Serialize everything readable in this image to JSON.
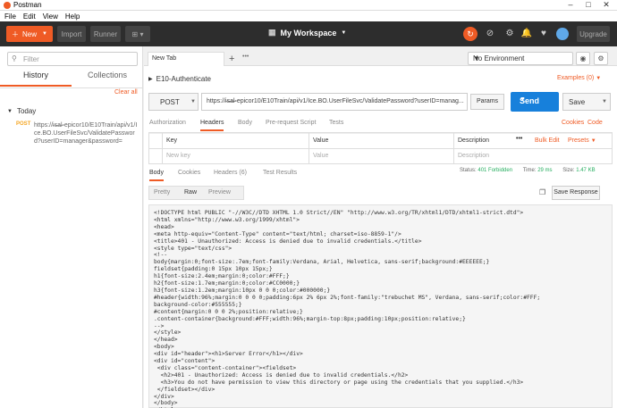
{
  "titlebar": {
    "title": "Postman",
    "min": "–",
    "max": "□",
    "close": "✕"
  },
  "menu": [
    "File",
    "Edit",
    "View",
    "Help"
  ],
  "toolbar": {
    "new_label": "New",
    "import_label": "Import",
    "runner_label": "Runner",
    "workspace": "My Workspace",
    "upgrade_label": "Upgrade"
  },
  "sidebar": {
    "filter_placeholder": "Filter",
    "tabs": [
      "History",
      "Collections"
    ],
    "clear_all": "Clear all",
    "group": "Today",
    "item": {
      "method": "POST",
      "url": "https://i̶s̶a̶l̶-epicor10/E10Train/api/v1/Ice.BO.UserFileSvc/ValidatePassword?userID=manager&password="
    }
  },
  "tabbar": {
    "tab_label": "New Tab",
    "new_tab": "+"
  },
  "environment": {
    "selected": "No Environment"
  },
  "request": {
    "name": "E10-Authenticate",
    "examples": "Examples (0)",
    "method": "POST",
    "url": "https://i̶s̶a̶l̶-epicor10/E10Train/api/v1/Ice.BO.UserFileSvc/ValidatePassword?userID=manag...",
    "params_label": "Params",
    "send_label": "Send",
    "save_label": "Save"
  },
  "subtabs": [
    "Authorization",
    "Headers",
    "Body",
    "Pre-request Script",
    "Tests"
  ],
  "links": {
    "cookies": "Cookies",
    "code": "Code"
  },
  "headers_table": {
    "col_key": "Key",
    "col_value": "Value",
    "col_description": "Description",
    "bulk_edit": "Bulk Edit",
    "presets": "Presets",
    "new_key": "New key",
    "new_value": "Value",
    "new_desc": "Description"
  },
  "response_tabs": [
    "Body",
    "Cookies",
    "Headers (6)",
    "Test Results"
  ],
  "status": {
    "status_label": "Status:",
    "status_value": "401 Forbidden",
    "time_label": "Time:",
    "time_value": "29 ms",
    "size_label": "Size:",
    "size_value": "1.47 KB"
  },
  "view_modes": [
    "Pretty",
    "Raw",
    "Preview"
  ],
  "save_response": "Save Response",
  "response_body": "<!DOCTYPE html PUBLIC \"-//W3C//DTD XHTML 1.0 Strict//EN\" \"http://www.w3.org/TR/xhtml1/DTD/xhtml1-strict.dtd\">\n<html xmlns=\"http://www.w3.org/1999/xhtml\">\n<head>\n<meta http-equiv=\"Content-Type\" content=\"text/html; charset=iso-8859-1\"/>\n<title>401 - Unauthorized: Access is denied due to invalid credentials.</title>\n<style type=\"text/css\">\n<!--\nbody{margin:0;font-size:.7em;font-family:Verdana, Arial, Helvetica, sans-serif;background:#EEEEEE;}\nfieldset{padding:0 15px 10px 15px;}\nh1{font-size:2.4em;margin:0;color:#FFF;}\nh2{font-size:1.7em;margin:0;color:#CC0000;}\nh3{font-size:1.2em;margin:10px 0 0 0;color:#000000;}\n#header{width:96%;margin:0 0 0 0;padding:6px 2% 6px 2%;font-family:\"trebuchet MS\", Verdana, sans-serif;color:#FFF;\nbackground-color:#555555;}\n#content{margin:0 0 0 2%;position:relative;}\n.content-container{background:#FFF;width:96%;margin-top:8px;padding:10px;position:relative;}\n-->\n</style>\n</head>\n<body>\n<div id=\"header\"><h1>Server Error</h1></div>\n<div id=\"content\">\n <div class=\"content-container\"><fieldset>\n  <h2>401 - Unauthorized: Access is denied due to invalid credentials.</h2>\n  <h3>You do not have permission to view this directory or page using the credentials that you supplied.</h3>\n </fieldset></div>\n</div>\n</body>\n</html>"
}
